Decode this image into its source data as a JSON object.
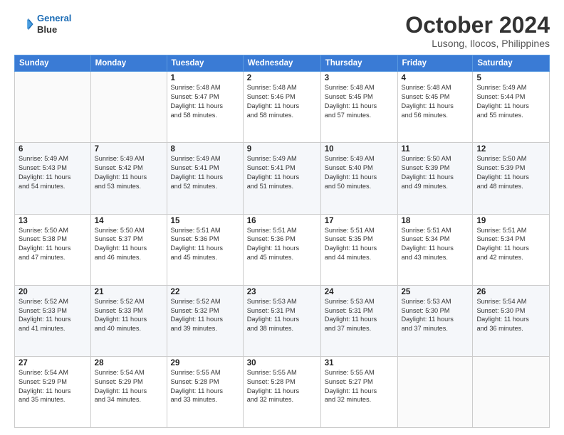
{
  "header": {
    "logo_line1": "General",
    "logo_line2": "Blue",
    "month": "October 2024",
    "location": "Lusong, Ilocos, Philippines"
  },
  "weekdays": [
    "Sunday",
    "Monday",
    "Tuesday",
    "Wednesday",
    "Thursday",
    "Friday",
    "Saturday"
  ],
  "weeks": [
    [
      {
        "day": "",
        "info": ""
      },
      {
        "day": "",
        "info": ""
      },
      {
        "day": "1",
        "info": "Sunrise: 5:48 AM\nSunset: 5:47 PM\nDaylight: 11 hours\nand 58 minutes."
      },
      {
        "day": "2",
        "info": "Sunrise: 5:48 AM\nSunset: 5:46 PM\nDaylight: 11 hours\nand 58 minutes."
      },
      {
        "day": "3",
        "info": "Sunrise: 5:48 AM\nSunset: 5:45 PM\nDaylight: 11 hours\nand 57 minutes."
      },
      {
        "day": "4",
        "info": "Sunrise: 5:48 AM\nSunset: 5:45 PM\nDaylight: 11 hours\nand 56 minutes."
      },
      {
        "day": "5",
        "info": "Sunrise: 5:49 AM\nSunset: 5:44 PM\nDaylight: 11 hours\nand 55 minutes."
      }
    ],
    [
      {
        "day": "6",
        "info": "Sunrise: 5:49 AM\nSunset: 5:43 PM\nDaylight: 11 hours\nand 54 minutes."
      },
      {
        "day": "7",
        "info": "Sunrise: 5:49 AM\nSunset: 5:42 PM\nDaylight: 11 hours\nand 53 minutes."
      },
      {
        "day": "8",
        "info": "Sunrise: 5:49 AM\nSunset: 5:41 PM\nDaylight: 11 hours\nand 52 minutes."
      },
      {
        "day": "9",
        "info": "Sunrise: 5:49 AM\nSunset: 5:41 PM\nDaylight: 11 hours\nand 51 minutes."
      },
      {
        "day": "10",
        "info": "Sunrise: 5:49 AM\nSunset: 5:40 PM\nDaylight: 11 hours\nand 50 minutes."
      },
      {
        "day": "11",
        "info": "Sunrise: 5:50 AM\nSunset: 5:39 PM\nDaylight: 11 hours\nand 49 minutes."
      },
      {
        "day": "12",
        "info": "Sunrise: 5:50 AM\nSunset: 5:39 PM\nDaylight: 11 hours\nand 48 minutes."
      }
    ],
    [
      {
        "day": "13",
        "info": "Sunrise: 5:50 AM\nSunset: 5:38 PM\nDaylight: 11 hours\nand 47 minutes."
      },
      {
        "day": "14",
        "info": "Sunrise: 5:50 AM\nSunset: 5:37 PM\nDaylight: 11 hours\nand 46 minutes."
      },
      {
        "day": "15",
        "info": "Sunrise: 5:51 AM\nSunset: 5:36 PM\nDaylight: 11 hours\nand 45 minutes."
      },
      {
        "day": "16",
        "info": "Sunrise: 5:51 AM\nSunset: 5:36 PM\nDaylight: 11 hours\nand 45 minutes."
      },
      {
        "day": "17",
        "info": "Sunrise: 5:51 AM\nSunset: 5:35 PM\nDaylight: 11 hours\nand 44 minutes."
      },
      {
        "day": "18",
        "info": "Sunrise: 5:51 AM\nSunset: 5:34 PM\nDaylight: 11 hours\nand 43 minutes."
      },
      {
        "day": "19",
        "info": "Sunrise: 5:51 AM\nSunset: 5:34 PM\nDaylight: 11 hours\nand 42 minutes."
      }
    ],
    [
      {
        "day": "20",
        "info": "Sunrise: 5:52 AM\nSunset: 5:33 PM\nDaylight: 11 hours\nand 41 minutes."
      },
      {
        "day": "21",
        "info": "Sunrise: 5:52 AM\nSunset: 5:33 PM\nDaylight: 11 hours\nand 40 minutes."
      },
      {
        "day": "22",
        "info": "Sunrise: 5:52 AM\nSunset: 5:32 PM\nDaylight: 11 hours\nand 39 minutes."
      },
      {
        "day": "23",
        "info": "Sunrise: 5:53 AM\nSunset: 5:31 PM\nDaylight: 11 hours\nand 38 minutes."
      },
      {
        "day": "24",
        "info": "Sunrise: 5:53 AM\nSunset: 5:31 PM\nDaylight: 11 hours\nand 37 minutes."
      },
      {
        "day": "25",
        "info": "Sunrise: 5:53 AM\nSunset: 5:30 PM\nDaylight: 11 hours\nand 37 minutes."
      },
      {
        "day": "26",
        "info": "Sunrise: 5:54 AM\nSunset: 5:30 PM\nDaylight: 11 hours\nand 36 minutes."
      }
    ],
    [
      {
        "day": "27",
        "info": "Sunrise: 5:54 AM\nSunset: 5:29 PM\nDaylight: 11 hours\nand 35 minutes."
      },
      {
        "day": "28",
        "info": "Sunrise: 5:54 AM\nSunset: 5:29 PM\nDaylight: 11 hours\nand 34 minutes."
      },
      {
        "day": "29",
        "info": "Sunrise: 5:55 AM\nSunset: 5:28 PM\nDaylight: 11 hours\nand 33 minutes."
      },
      {
        "day": "30",
        "info": "Sunrise: 5:55 AM\nSunset: 5:28 PM\nDaylight: 11 hours\nand 32 minutes."
      },
      {
        "day": "31",
        "info": "Sunrise: 5:55 AM\nSunset: 5:27 PM\nDaylight: 11 hours\nand 32 minutes."
      },
      {
        "day": "",
        "info": ""
      },
      {
        "day": "",
        "info": ""
      }
    ]
  ]
}
